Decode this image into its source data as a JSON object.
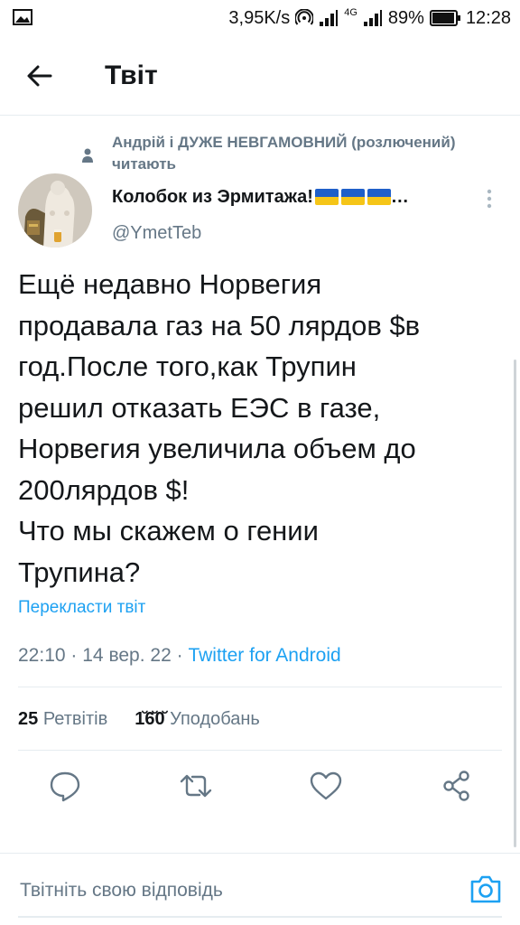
{
  "status_bar": {
    "speed": "3,95K/s",
    "network": "4G",
    "battery": "89%",
    "time": "12:28",
    "icons": [
      "image-icon",
      "hotspot-icon",
      "signal-icon",
      "battery-icon"
    ]
  },
  "app_bar": {
    "title": "Твіт",
    "back_icon": "arrow-left-icon"
  },
  "tweet": {
    "social_context": "Андрій і ДУЖЕ НЕВГАМОВНИЙ (розлючений) читають",
    "author_name": "Колобок из Эрмитажа!",
    "author_name_ellipsis": "…",
    "author_handle": "@YmetTeb",
    "text": "Ещё недавно Норвегия\nпродавала газ на 50 лярдов $в\nгод.После того,как Трупин\nрешил отказать ЕЭС в газе,\nНорвегия увеличила объем до\n200лярдов $!\nЧто мы скажем о гении\nТрупина?",
    "translate_label": "Перекласти твіт",
    "time": "22:10",
    "separator": "·",
    "date": "14 вер. 22",
    "source": "Twitter for Android",
    "retweets_count": "25",
    "retweets_label": "Ретвітів",
    "likes_count": "1̆6̆0̆",
    "likes_label": "Уподобань"
  },
  "actions": [
    "reply-icon",
    "retweet-icon",
    "like-icon",
    "share-icon"
  ],
  "reply": {
    "placeholder": "Твітніть свою відповідь",
    "camera_icon": "camera-icon"
  },
  "colors": {
    "accent": "#1da1f2",
    "secondary_text": "#657786",
    "divider": "#e6ecf0",
    "flag_blue": "#1f5fc9",
    "flag_yellow": "#f5c518"
  }
}
